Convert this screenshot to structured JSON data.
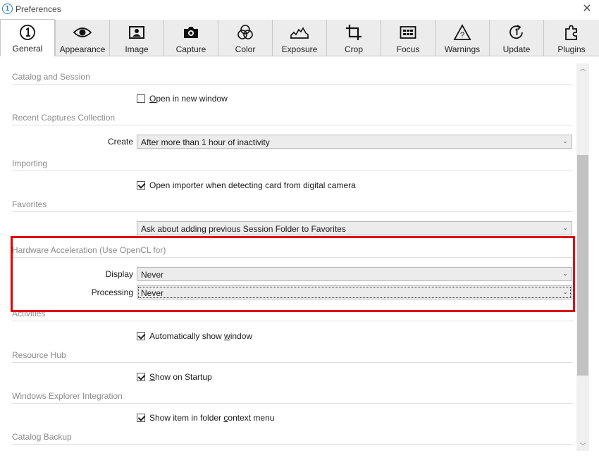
{
  "window": {
    "title": "Preferences",
    "app_icon_glyph": "1",
    "close_glyph": "✕"
  },
  "tabs": [
    {
      "label": "General",
      "icon": "general-icon",
      "active": true
    },
    {
      "label": "Appearance",
      "icon": "eye-icon"
    },
    {
      "label": "Image",
      "icon": "image-icon"
    },
    {
      "label": "Capture",
      "icon": "camera-icon"
    },
    {
      "label": "Color",
      "icon": "color-circles-icon"
    },
    {
      "label": "Exposure",
      "icon": "histogram-icon"
    },
    {
      "label": "Crop",
      "icon": "crop-icon"
    },
    {
      "label": "Focus",
      "icon": "focus-grid-icon"
    },
    {
      "label": "Warnings",
      "icon": "warning-triangle-icon"
    },
    {
      "label": "Update",
      "icon": "update-icon"
    },
    {
      "label": "Plugins",
      "icon": "puzzle-icon"
    }
  ],
  "sections": {
    "catalog_session": {
      "title": "Catalog and Session",
      "open_new_window": {
        "label_pre": "",
        "label_u": "O",
        "label_post": "pen in new window",
        "checked": false
      }
    },
    "recent_captures": {
      "title": "Recent Captures Collection",
      "create_label": "Create",
      "create_value": "After more than 1 hour of inactivity"
    },
    "importing": {
      "title": "Importing",
      "open_importer": {
        "label": "Open importer when detecting card from digital camera",
        "checked": true
      }
    },
    "favorites": {
      "title": "Favorites",
      "value": "Ask about adding previous Session Folder to Favorites"
    },
    "hardware": {
      "title": "Hardware Acceleration (Use OpenCL for)",
      "display_label": "Display",
      "display_value": "Never",
      "processing_label": "Processing",
      "processing_value": "Never"
    },
    "activities": {
      "title": "Activities",
      "auto_show": {
        "label_pre": "Automatically show ",
        "label_u": "w",
        "label_post": "indow",
        "checked": true
      }
    },
    "resource_hub": {
      "title": "Resource Hub",
      "show_startup": {
        "label_pre": "",
        "label_u": "S",
        "label_post": "how on Startup",
        "checked": true
      }
    },
    "explorer": {
      "title": "Windows Explorer Integration",
      "show_item": {
        "label_pre": "Show item in folder ",
        "label_u": "c",
        "label_post": "ontext menu",
        "checked": true
      }
    },
    "backup": {
      "title": "Catalog Backup"
    }
  },
  "colors": {
    "highlight": "#e00000"
  }
}
